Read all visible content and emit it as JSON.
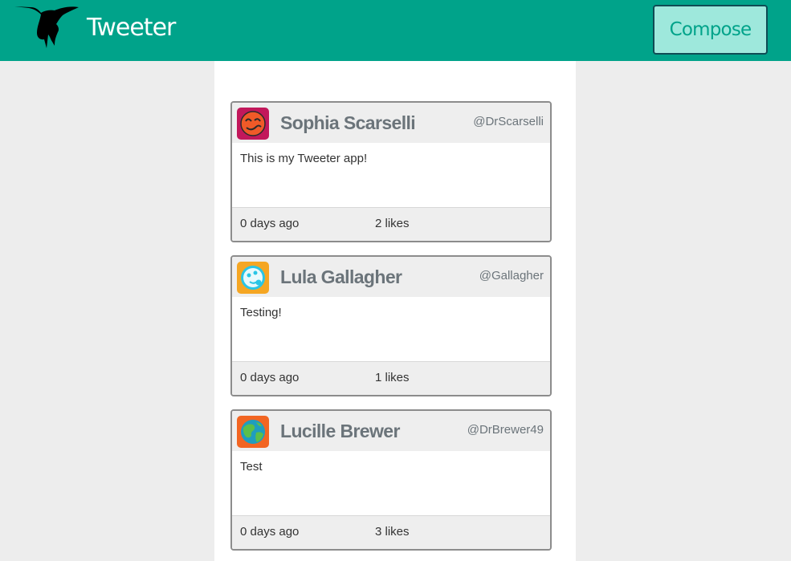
{
  "navbar": {
    "brand": "Tweeter",
    "logo_icon": "hummingbird-icon",
    "compose_label": "Compose",
    "background_color": "#00a38a",
    "compose_bg_color": "#9ee8dc"
  },
  "tweets": [
    {
      "name": "Sophia Scarselli",
      "handle": "@DrScarselli",
      "text": "This is my Tweeter app!",
      "time": "0 days ago",
      "likes": "2 likes",
      "avatar_icon": "smiley-avatar-icon",
      "avatar_color": "#c2185b"
    },
    {
      "name": "Lula Gallagher",
      "handle": "@Gallagher",
      "text": "Testing!",
      "time": "0 days ago",
      "likes": "1 likes",
      "avatar_icon": "face-avatar-icon",
      "avatar_color": "#f5a623"
    },
    {
      "name": "Lucille Brewer",
      "handle": "@DrBrewer49",
      "text": "Test",
      "time": "0 days ago",
      "likes": "3 likes",
      "avatar_icon": "globe-avatar-icon",
      "avatar_color": "#f26522"
    }
  ]
}
